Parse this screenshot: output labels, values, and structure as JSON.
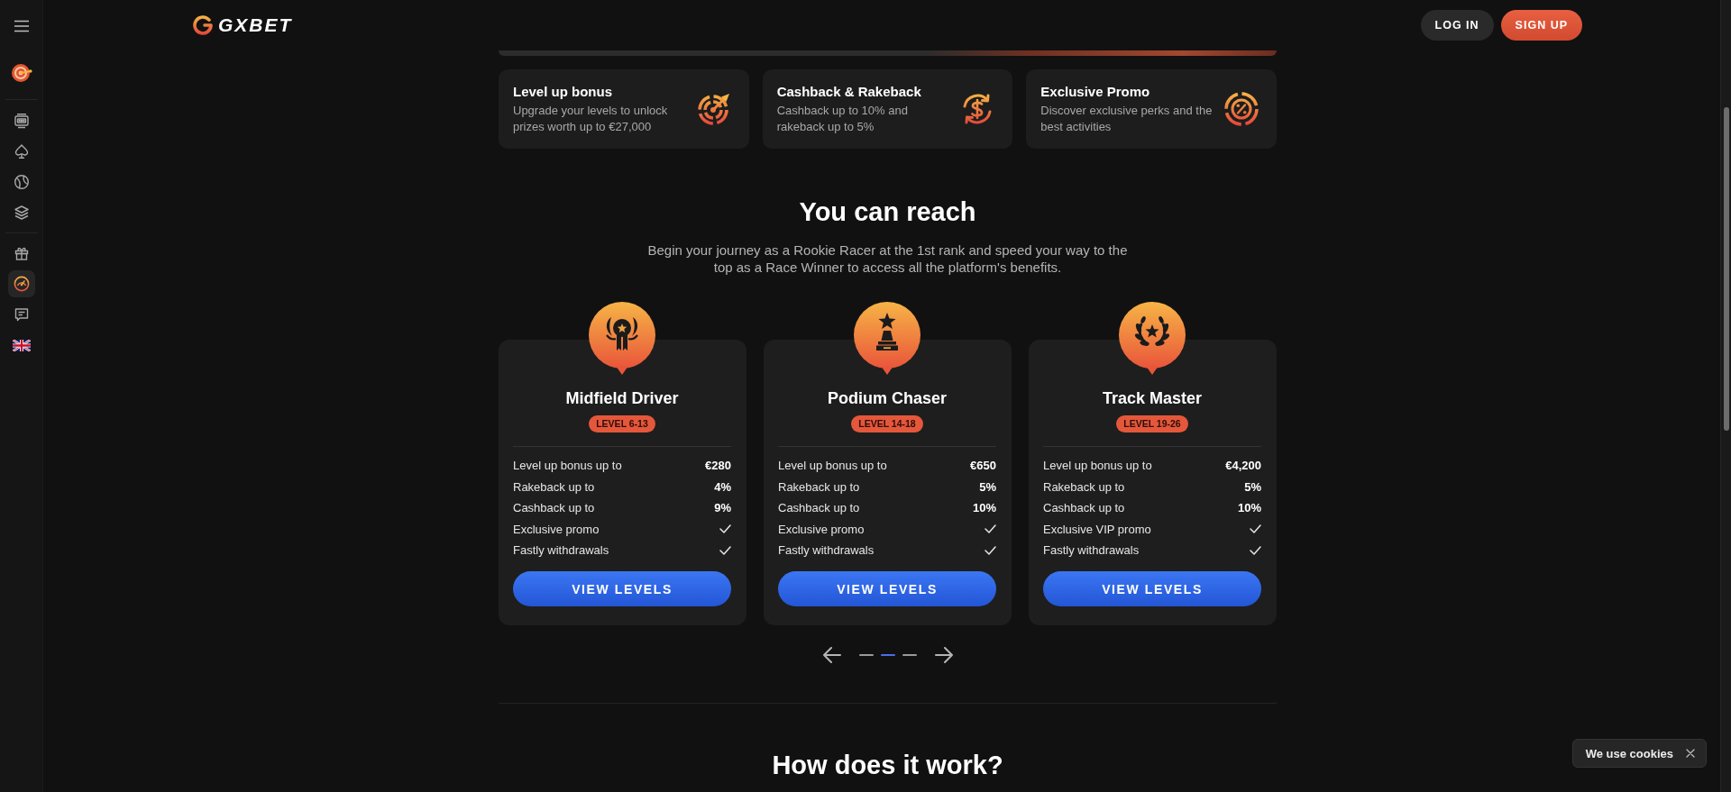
{
  "header": {
    "logo": "GXBET",
    "buttons": [
      {
        "label": "LOG IN",
        "kind": "secondary"
      },
      {
        "label": "SIGN UP",
        "kind": "primary"
      }
    ]
  },
  "sidebar": {
    "sections": [
      {
        "items": [
          {
            "selected": false
          }
        ]
      },
      {
        "items": [
          {
            "selected": false
          },
          {
            "selected": false
          },
          {
            "selected": false
          },
          {
            "selected": false
          }
        ]
      },
      {
        "items": [
          {
            "selected": false
          },
          {
            "selected": true
          },
          {
            "selected": false
          },
          {
            "selected": false
          }
        ]
      }
    ]
  },
  "features": [
    {
      "title": "Level up bonus",
      "description": "Upgrade your levels to unlock prizes worth up to €27,000"
    },
    {
      "title": "Cashback & Rakeback",
      "description": "Cashback up to 10% and rakeback up to 5%"
    },
    {
      "title": "Exclusive Promo",
      "description": "Discover exclusive perks and the best activities"
    }
  ],
  "reach": {
    "title": "You can reach",
    "subtitle": "Begin your journey as a Rookie Racer at the 1st rank and speed your way to the top as a Race Winner to access all the platform's benefits.",
    "levels": [
      {
        "title": "Midfield Driver",
        "range": "LEVEL 6-13",
        "perks": [
          {
            "kind": "value",
            "label": "Level up bonus up to",
            "value": "€280"
          },
          {
            "kind": "value",
            "label": "Rakeback up to",
            "value": "4%"
          },
          {
            "kind": "value",
            "label": "Cashback up to",
            "value": "9%"
          },
          {
            "kind": "check",
            "label": "Exclusive promo",
            "checked": true
          },
          {
            "kind": "check",
            "label": "Fastly withdrawals",
            "checked": true
          }
        ],
        "button": "VIEW LEVELS"
      },
      {
        "title": "Podium Chaser",
        "range": "LEVEL 14-18",
        "perks": [
          {
            "kind": "value",
            "label": "Level up bonus up to",
            "value": "€650"
          },
          {
            "kind": "value",
            "label": "Rakeback up to",
            "value": "5%"
          },
          {
            "kind": "value",
            "label": "Cashback up to",
            "value": "10%"
          },
          {
            "kind": "check",
            "label": "Exclusive promo",
            "checked": true
          },
          {
            "kind": "check",
            "label": "Fastly withdrawals",
            "checked": true
          }
        ],
        "button": "VIEW LEVELS"
      },
      {
        "title": "Track Master",
        "range": "LEVEL 19-26",
        "perks": [
          {
            "kind": "value",
            "label": "Level up bonus up to",
            "value": "€4,200"
          },
          {
            "kind": "value",
            "label": "Rakeback up to",
            "value": "5%"
          },
          {
            "kind": "value",
            "label": "Cashback up to",
            "value": "10%"
          },
          {
            "kind": "check",
            "label": "Exclusive VIP promo",
            "checked": true
          },
          {
            "kind": "check",
            "label": "Fastly withdrawals",
            "checked": true
          }
        ],
        "button": "VIEW LEVELS"
      }
    ],
    "pagination": [
      {
        "selected": false
      },
      {
        "selected": true
      },
      {
        "selected": false
      }
    ]
  },
  "how_it_works": {
    "title": "How does it work?"
  },
  "cookie_toast": {
    "text": "We use cookies"
  }
}
